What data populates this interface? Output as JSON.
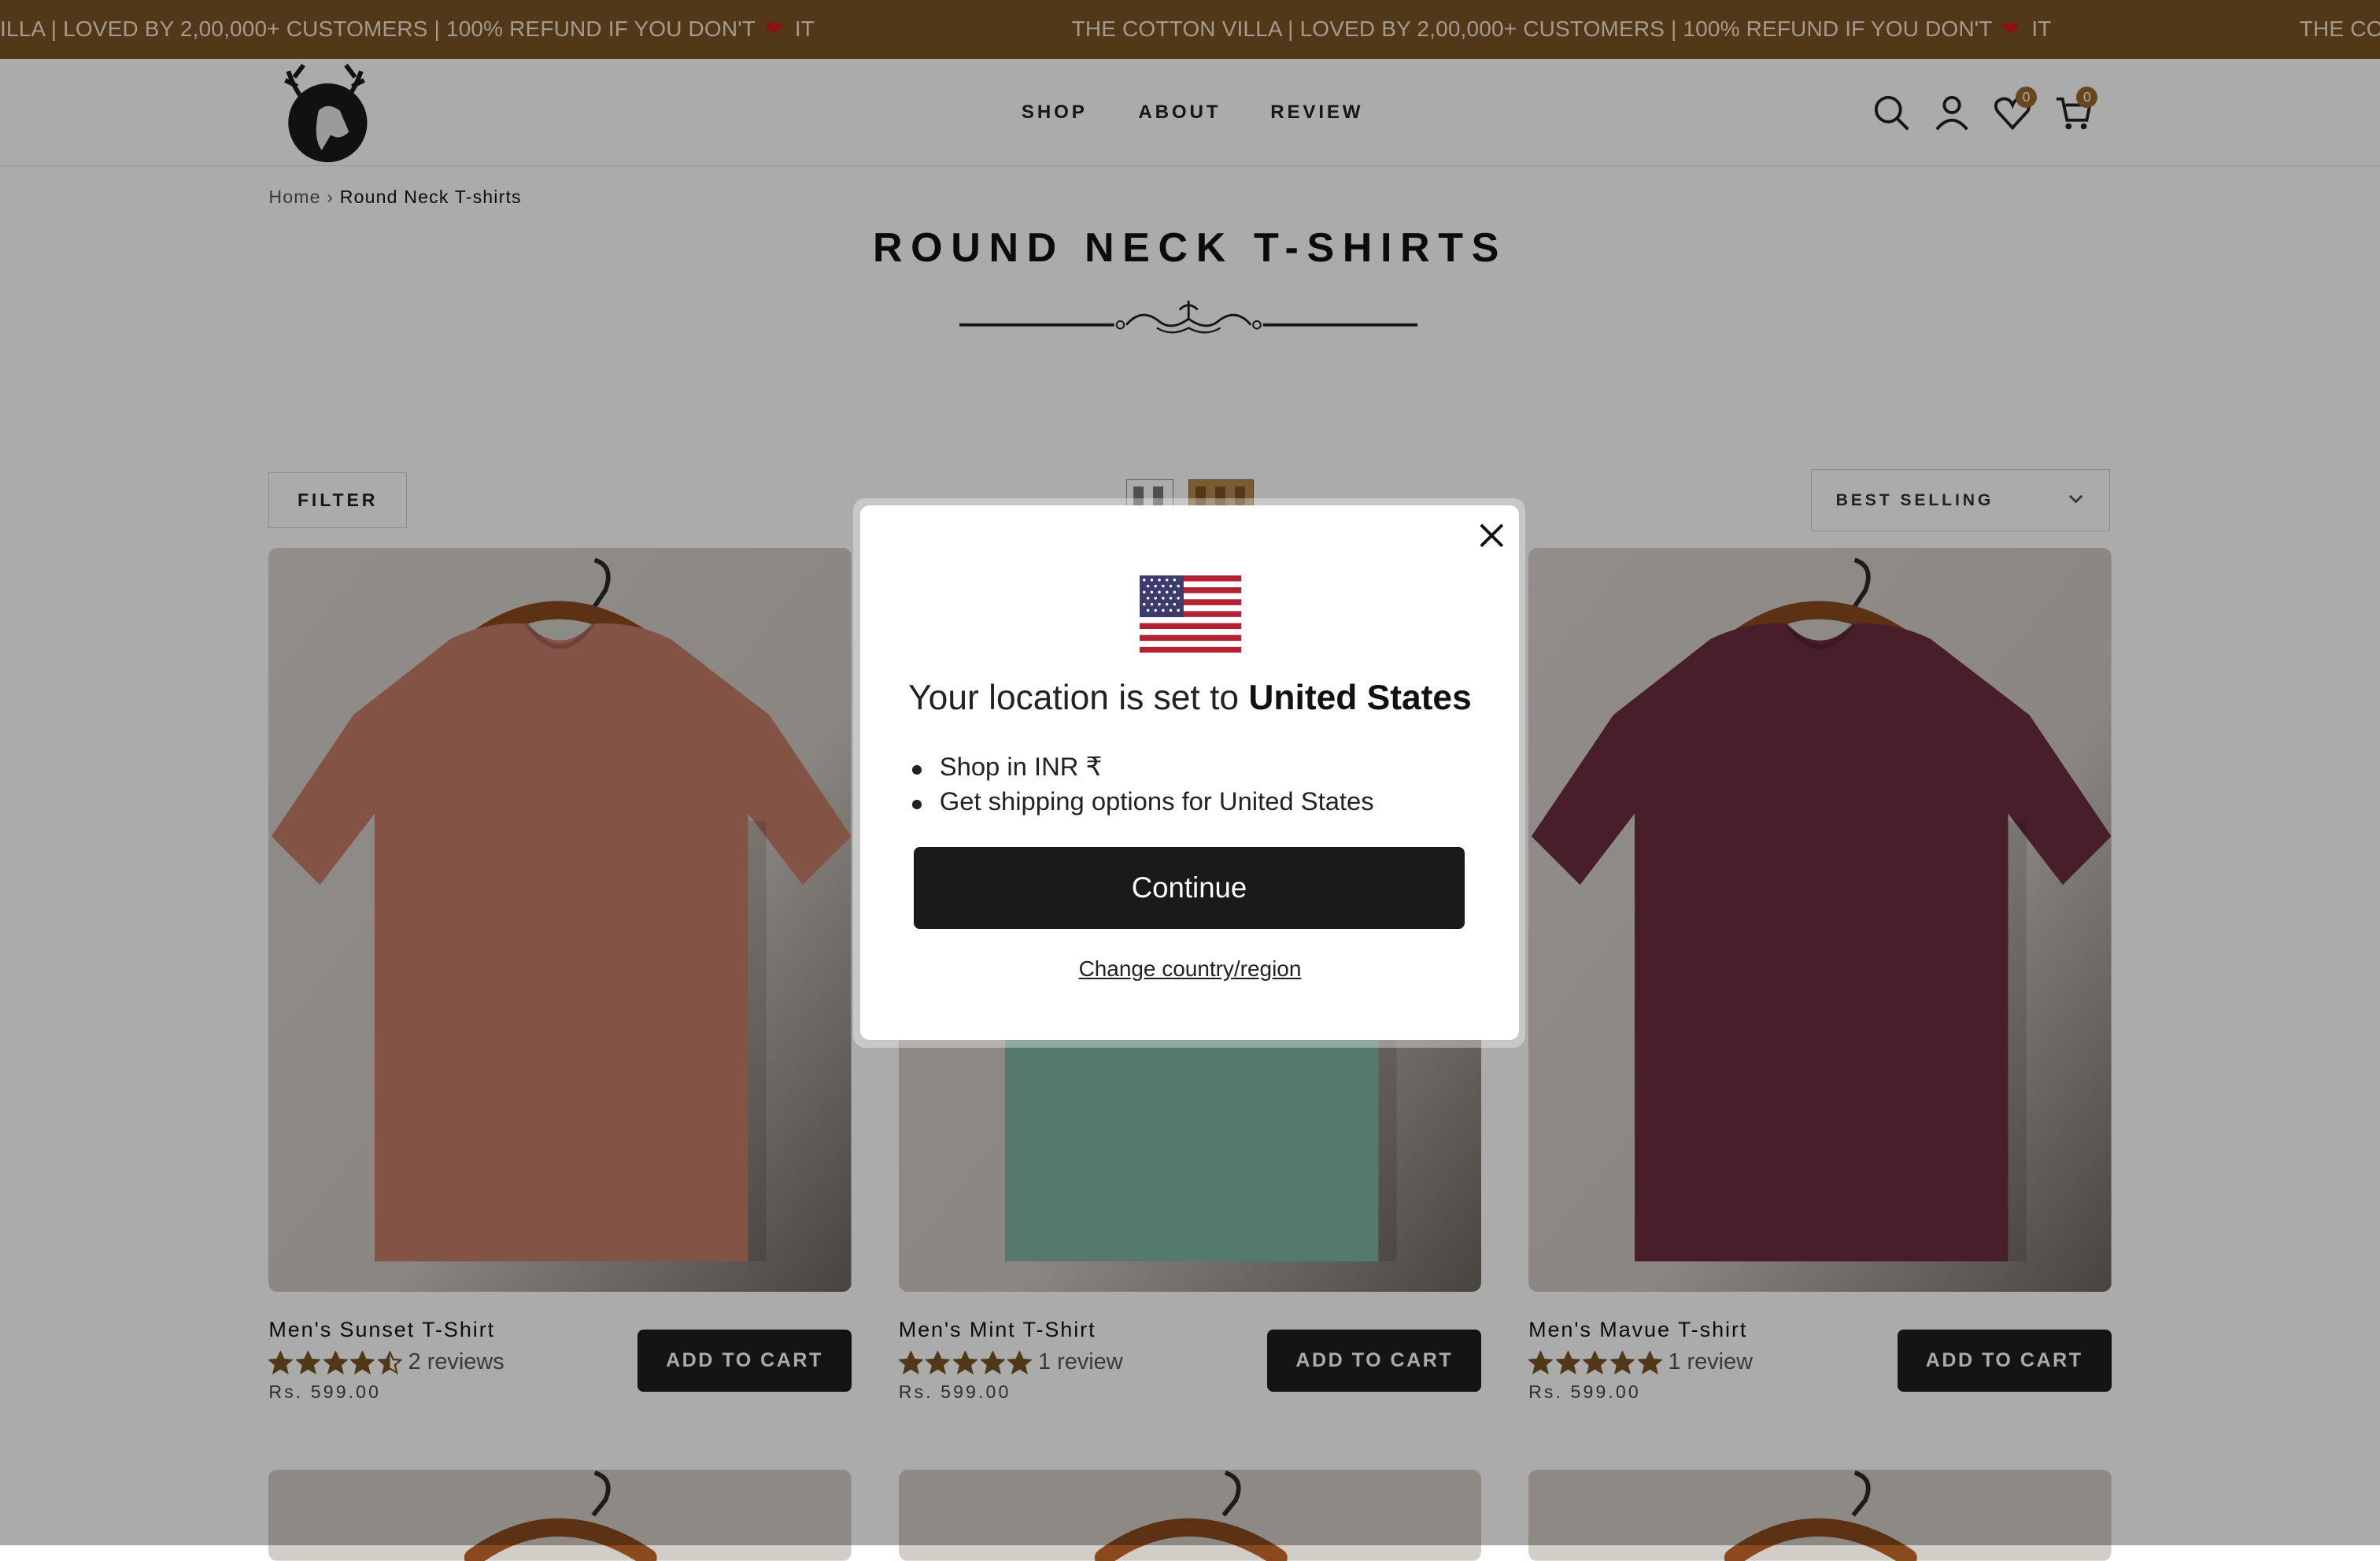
{
  "announcement": {
    "prefix": "ILLA | LOVED BY 2,00,000+ CUSTOMERS | 100% REFUND IF YOU DON'T",
    "suffix": "IT",
    "full": "THE COTTON VILLA | LOVED BY 2,00,000+ CUSTOMERS | 100% REFUND IF YOU DON'T",
    "tail": "THE CO"
  },
  "nav": {
    "items": [
      "SHOP",
      "ABOUT",
      "REVIEW"
    ]
  },
  "header": {
    "wishlist_count": "0",
    "cart_count": "0"
  },
  "breadcrumb": {
    "home": "Home",
    "separator": "›",
    "current": "Round Neck T-shirts"
  },
  "page": {
    "title": "ROUND NECK T-SHIRTS"
  },
  "toolbar": {
    "filter_label": "FILTER",
    "sort_label": "BEST SELLING"
  },
  "products": [
    {
      "name": "Men's Sunset T-Shirt",
      "rating": 4.5,
      "reviews": "2 reviews",
      "price": "Rs. 599.00",
      "cta": "ADD TO CART",
      "color": "#c47c67"
    },
    {
      "name": "Men's Mint T-Shirt",
      "rating": 5,
      "reviews": "1 review",
      "price": "Rs. 599.00",
      "cta": "ADD TO CART",
      "color": "#7fb7a0"
    },
    {
      "name": "Men's Mavue T-shirt",
      "rating": 5,
      "reviews": "1 review",
      "price": "Rs. 599.00",
      "cta": "ADD TO CART",
      "color": "#6b2e3e"
    }
  ],
  "modal": {
    "location_prefix": "Your location is set to",
    "country": "United States",
    "bullets": [
      "Shop in INR ₹",
      "Get shipping options for United States"
    ],
    "continue_label": "Continue",
    "change_label": "Change country/region"
  },
  "colors": {
    "brand": "#7a5426",
    "accent": "#9a6a2d",
    "button": "#1f1f1f",
    "star": "#7a5426"
  }
}
